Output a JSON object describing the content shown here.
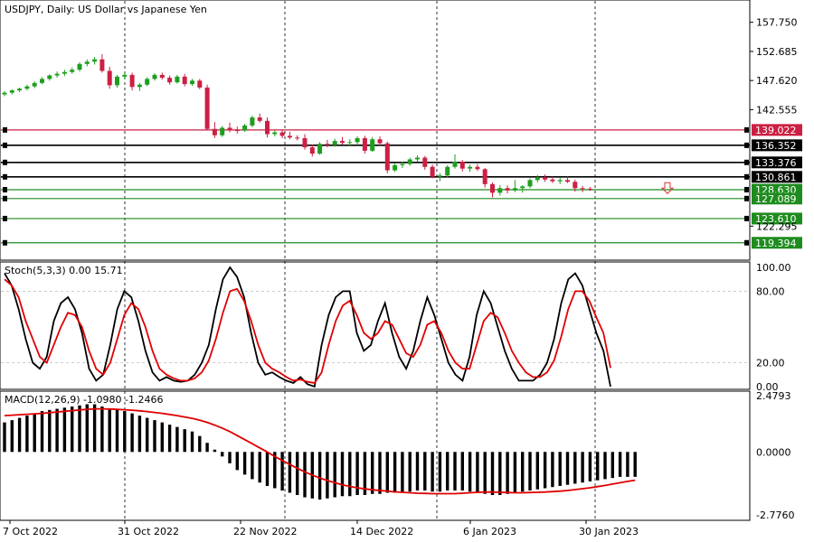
{
  "header": {
    "symbol_title": "USDJPY, Daily:  US Dollar vs Japanese Yen",
    "stoch_label": "Stoch(5,3,3) 0.00 15.71",
    "macd_label": "MACD(12,26,9) -1.0980 -1.2466"
  },
  "colors": {
    "bull": "#1e9e1e",
    "bear": "#cc1f43",
    "stoch_main": "#000000",
    "stoch_signal": "#e00000",
    "macd_hist": "#000000",
    "macd_signal": "#e00000",
    "res_red": "#cc1f43",
    "level_black": "#000000",
    "support_green": "#1e8c1e",
    "arrow": "#e03030"
  },
  "chart_data": [
    {
      "type": "candlestick",
      "ylim": [
        117.0,
        161.0
      ],
      "y_ticks": [
        "157.750",
        "152.685",
        "147.620",
        "142.555",
        "122.295"
      ],
      "x_ticks": [
        "7 Oct 2022",
        "31 Oct 2022",
        "22 Nov 2022",
        "14 Dec 2022",
        "6 Jan 2023",
        "30 Jan 2023"
      ],
      "period_separators": [
        "31 Oct 2022",
        "22 Nov 2022",
        "14 Dec 2022",
        "6 Jan 2023",
        "30 Jan 2023"
      ],
      "levels": [
        {
          "value": 139.022,
          "label": "139.022",
          "kind": "resistance"
        },
        {
          "value": 136.352,
          "label": "136.352",
          "kind": "level"
        },
        {
          "value": 133.376,
          "label": "133.376",
          "kind": "level"
        },
        {
          "value": 130.861,
          "label": "130.861",
          "kind": "level"
        },
        {
          "value": 128.63,
          "label": "128.630",
          "kind": "support"
        },
        {
          "value": 127.089,
          "label": "127.089",
          "kind": "support"
        },
        {
          "value": 123.61,
          "label": "123.610",
          "kind": "support"
        },
        {
          "value": 119.394,
          "label": "119.394",
          "kind": "support"
        }
      ],
      "arrow": {
        "direction": "down",
        "index": 66,
        "value": 128.9
      },
      "candles": [
        [
          145.2,
          145.8,
          144.9,
          145.5
        ],
        [
          145.5,
          146.1,
          145.2,
          145.9
        ],
        [
          145.9,
          146.4,
          145.6,
          146.2
        ],
        [
          146.2,
          146.9,
          145.9,
          146.6
        ],
        [
          146.6,
          147.5,
          146.3,
          147.2
        ],
        [
          147.2,
          148.2,
          147.0,
          147.9
        ],
        [
          147.9,
          148.7,
          147.6,
          148.5
        ],
        [
          148.5,
          149.2,
          148.1,
          148.8
        ],
        [
          148.8,
          149.5,
          148.4,
          149.1
        ],
        [
          149.1,
          149.9,
          148.8,
          149.5
        ],
        [
          149.5,
          150.8,
          149.2,
          150.5
        ],
        [
          150.5,
          151.3,
          150.1,
          150.9
        ],
        [
          150.9,
          151.7,
          150.4,
          151.3
        ],
        [
          151.3,
          152.2,
          149.0,
          149.3
        ],
        [
          149.3,
          150.0,
          146.2,
          146.8
        ],
        [
          146.8,
          148.6,
          146.4,
          148.3
        ],
        [
          148.3,
          149.0,
          147.8,
          148.6
        ],
        [
          148.6,
          149.0,
          145.9,
          146.5
        ],
        [
          146.5,
          147.2,
          145.8,
          146.9
        ],
        [
          146.9,
          148.2,
          146.6,
          147.9
        ],
        [
          147.9,
          148.9,
          147.6,
          148.6
        ],
        [
          148.6,
          149.0,
          147.8,
          148.1
        ],
        [
          148.1,
          148.5,
          146.9,
          147.3
        ],
        [
          147.3,
          148.6,
          147.1,
          148.3
        ],
        [
          148.3,
          148.8,
          146.6,
          147.0
        ],
        [
          147.0,
          147.9,
          146.7,
          147.6
        ],
        [
          147.6,
          147.9,
          146.1,
          146.4
        ],
        [
          146.4,
          146.9,
          138.9,
          139.2
        ],
        [
          139.2,
          140.4,
          137.6,
          138.1
        ],
        [
          138.1,
          139.7,
          137.8,
          139.4
        ],
        [
          139.4,
          140.3,
          138.6,
          139.0
        ],
        [
          139.0,
          139.6,
          138.4,
          138.9
        ],
        [
          138.9,
          140.1,
          138.7,
          139.8
        ],
        [
          139.8,
          141.5,
          139.5,
          141.2
        ],
        [
          141.2,
          141.9,
          140.3,
          140.6
        ],
        [
          140.6,
          141.2,
          137.7,
          138.3
        ],
        [
          138.3,
          138.9,
          137.9,
          138.6
        ],
        [
          138.6,
          139.1,
          137.6,
          138.0
        ],
        [
          138.0,
          138.7,
          137.4,
          137.7
        ],
        [
          137.7,
          138.1,
          137.2,
          137.6
        ],
        [
          137.6,
          138.3,
          135.6,
          136.0
        ],
        [
          136.0,
          136.5,
          134.4,
          134.9
        ],
        [
          134.9,
          136.9,
          134.7,
          136.6
        ],
        [
          136.6,
          137.3,
          136.0,
          136.4
        ],
        [
          136.4,
          137.5,
          136.1,
          137.1
        ],
        [
          137.1,
          137.8,
          136.5,
          136.8
        ],
        [
          136.8,
          137.4,
          136.2,
          136.9
        ],
        [
          136.9,
          137.9,
          136.4,
          137.6
        ],
        [
          137.6,
          138.0,
          134.9,
          135.4
        ],
        [
          135.4,
          137.8,
          135.2,
          137.4
        ],
        [
          137.4,
          137.9,
          136.3,
          136.7
        ],
        [
          136.7,
          137.0,
          131.5,
          132.0
        ],
        [
          132.0,
          133.3,
          131.7,
          132.9
        ],
        [
          132.9,
          133.5,
          132.4,
          133.1
        ],
        [
          133.1,
          134.2,
          132.8,
          133.9
        ],
        [
          133.9,
          134.6,
          133.5,
          134.2
        ],
        [
          134.2,
          134.5,
          132.1,
          132.6
        ],
        [
          132.6,
          133.0,
          130.6,
          130.9
        ],
        [
          130.9,
          131.5,
          130.1,
          131.1
        ],
        [
          131.1,
          132.9,
          130.8,
          132.6
        ],
        [
          132.6,
          134.8,
          132.3,
          133.5
        ],
        [
          133.5,
          133.8,
          131.8,
          132.3
        ],
        [
          132.3,
          133.0,
          131.7,
          132.6
        ],
        [
          132.6,
          133.1,
          131.9,
          132.2
        ],
        [
          132.2,
          132.4,
          129.0,
          129.6
        ],
        [
          129.6,
          129.9,
          127.3,
          128.1
        ],
        [
          128.1,
          129.4,
          127.6,
          128.9
        ],
        [
          128.9,
          129.4,
          128.0,
          128.5
        ],
        [
          128.5,
          130.3,
          128.2,
          128.9
        ],
        [
          128.9,
          129.4,
          128.1,
          129.2
        ],
        [
          129.2,
          130.6,
          128.9,
          130.3
        ],
        [
          130.3,
          131.2,
          129.9,
          130.8
        ],
        [
          130.8,
          131.3,
          130.0,
          130.4
        ],
        [
          130.4,
          130.9,
          129.8,
          130.1
        ],
        [
          130.1,
          130.8,
          129.6,
          130.3
        ],
        [
          130.3,
          130.9,
          129.8,
          130.0
        ],
        [
          130.0,
          130.4,
          128.3,
          128.9
        ],
        [
          128.9,
          129.3,
          128.2,
          128.8
        ],
        [
          128.8,
          129.1,
          128.4,
          128.63
        ]
      ]
    },
    {
      "type": "line",
      "name": "Stoch(5,3,3)",
      "ylim": [
        0,
        100
      ],
      "y_ticks": [
        "100.00",
        "80.00",
        "20.00",
        "0.00"
      ],
      "levels": [
        80,
        20
      ],
      "main": [
        95,
        85,
        65,
        40,
        20,
        15,
        25,
        55,
        70,
        75,
        65,
        45,
        15,
        5,
        10,
        35,
        65,
        80,
        75,
        55,
        30,
        12,
        5,
        8,
        5,
        4,
        5,
        10,
        20,
        35,
        65,
        90,
        100,
        92,
        75,
        45,
        20,
        10,
        12,
        8,
        5,
        3,
        8,
        2,
        0,
        35,
        60,
        75,
        80,
        80,
        45,
        30,
        35,
        55,
        70,
        45,
        25,
        15,
        30,
        55,
        75,
        60,
        40,
        20,
        10,
        5,
        25,
        60,
        80,
        70,
        50,
        30,
        15,
        5,
        5,
        5,
        10,
        20,
        40,
        70,
        90,
        95,
        85,
        65,
        45,
        30,
        0
      ],
      "signal": [
        90,
        85,
        75,
        55,
        40,
        25,
        20,
        35,
        50,
        62,
        60,
        50,
        30,
        15,
        10,
        20,
        40,
        60,
        70,
        65,
        50,
        30,
        15,
        10,
        7,
        5,
        5,
        7,
        12,
        22,
        40,
        62,
        80,
        82,
        72,
        55,
        35,
        20,
        15,
        12,
        8,
        5,
        6,
        4,
        3,
        12,
        35,
        55,
        68,
        72,
        60,
        45,
        40,
        45,
        55,
        52,
        40,
        28,
        25,
        35,
        52,
        55,
        45,
        30,
        20,
        15,
        15,
        35,
        55,
        62,
        58,
        45,
        30,
        20,
        12,
        8,
        8,
        12,
        22,
        42,
        65,
        80,
        80,
        72,
        58,
        45,
        15.71
      ]
    },
    {
      "type": "bar",
      "name": "MACD(12,26,9)",
      "ylim": [
        -2.776,
        2.4793
      ],
      "y_ticks": [
        "2.4793",
        "0.0000",
        "-2.7760"
      ],
      "histogram": [
        1.3,
        1.4,
        1.5,
        1.6,
        1.7,
        1.8,
        1.85,
        1.9,
        1.95,
        2.0,
        2.05,
        2.1,
        2.1,
        2.0,
        1.9,
        1.85,
        1.8,
        1.7,
        1.6,
        1.5,
        1.4,
        1.3,
        1.2,
        1.1,
        1.0,
        0.9,
        0.7,
        0.4,
        0.1,
        -0.2,
        -0.5,
        -0.8,
        -1.0,
        -1.2,
        -1.35,
        -1.5,
        -1.6,
        -1.7,
        -1.8,
        -1.9,
        -2.0,
        -2.05,
        -2.1,
        -2.05,
        -2.0,
        -1.95,
        -1.95,
        -1.9,
        -1.9,
        -1.85,
        -1.85,
        -1.8,
        -1.8,
        -1.75,
        -1.75,
        -1.7,
        -1.7,
        -1.75,
        -1.75,
        -1.7,
        -1.7,
        -1.7,
        -1.75,
        -1.8,
        -1.85,
        -1.9,
        -1.9,
        -1.85,
        -1.8,
        -1.75,
        -1.7,
        -1.65,
        -1.6,
        -1.55,
        -1.5,
        -1.45,
        -1.4,
        -1.35,
        -1.3,
        -1.25,
        -1.2,
        -1.15,
        -1.1,
        -1.1,
        -1.098
      ],
      "signal": [
        1.6,
        1.62,
        1.64,
        1.66,
        1.68,
        1.7,
        1.73,
        1.76,
        1.79,
        1.82,
        1.85,
        1.88,
        1.9,
        1.9,
        1.89,
        1.88,
        1.86,
        1.84,
        1.81,
        1.78,
        1.74,
        1.7,
        1.65,
        1.6,
        1.54,
        1.48,
        1.4,
        1.3,
        1.18,
        1.05,
        0.9,
        0.72,
        0.54,
        0.36,
        0.18,
        0.0,
        -0.2,
        -0.38,
        -0.55,
        -0.72,
        -0.88,
        -1.02,
        -1.15,
        -1.26,
        -1.36,
        -1.45,
        -1.52,
        -1.58,
        -1.63,
        -1.67,
        -1.7,
        -1.73,
        -1.76,
        -1.78,
        -1.8,
        -1.82,
        -1.83,
        -1.84,
        -1.84,
        -1.84,
        -1.84,
        -1.82,
        -1.8,
        -1.78,
        -1.77,
        -1.77,
        -1.78,
        -1.79,
        -1.8,
        -1.8,
        -1.79,
        -1.78,
        -1.77,
        -1.75,
        -1.73,
        -1.7,
        -1.66,
        -1.62,
        -1.58,
        -1.53,
        -1.48,
        -1.42,
        -1.36,
        -1.3,
        -1.2466
      ]
    }
  ]
}
